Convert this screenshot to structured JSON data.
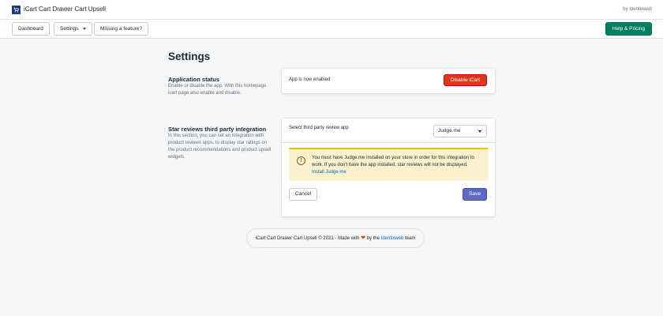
{
  "app": {
    "name": "iCart Cart Drawer Cart Upsell",
    "by": "by Identixweb",
    "logo_icon": "cart-icon"
  },
  "nav": {
    "dashboard": "Dashboard",
    "settings": "Settings",
    "missing_feature": "Missing a feature?",
    "help_pricing": "Help & Pricing"
  },
  "page": {
    "title": "Settings"
  },
  "app_status": {
    "title": "Application status",
    "description": "Enable or disable the app. With this homepage icart page also enable and disable.",
    "status_text": "App is now enabled",
    "disable_label": "Disable iCart"
  },
  "reviews": {
    "title": "Star reviews third party integration",
    "description": "In this section, you can set an integration with product reviews apps, to display star ratings on the product recommendations and product upsell widgets.",
    "select_label": "Select third party review app",
    "selected_app": "Judge.me",
    "warning_text": "You must have Judge.me installed on your store in order for this integration to work. If you don't have the app installed, star reviews will not be displayed.",
    "install_link": "Install Judge.me",
    "cancel_label": "Cancel",
    "save_label": "Save"
  },
  "footer": {
    "prefix": "iCart Cart Drawer Cart Upsell © 2021 - Made with",
    "by_the": "by the",
    "company": "Identixweb",
    "suffix": "team"
  },
  "colors": {
    "primary_green": "#008060",
    "danger": "#de3618",
    "save_indigo": "#5c6ac4",
    "warning_bg": "#fcf1cd",
    "link": "#006fbb"
  }
}
